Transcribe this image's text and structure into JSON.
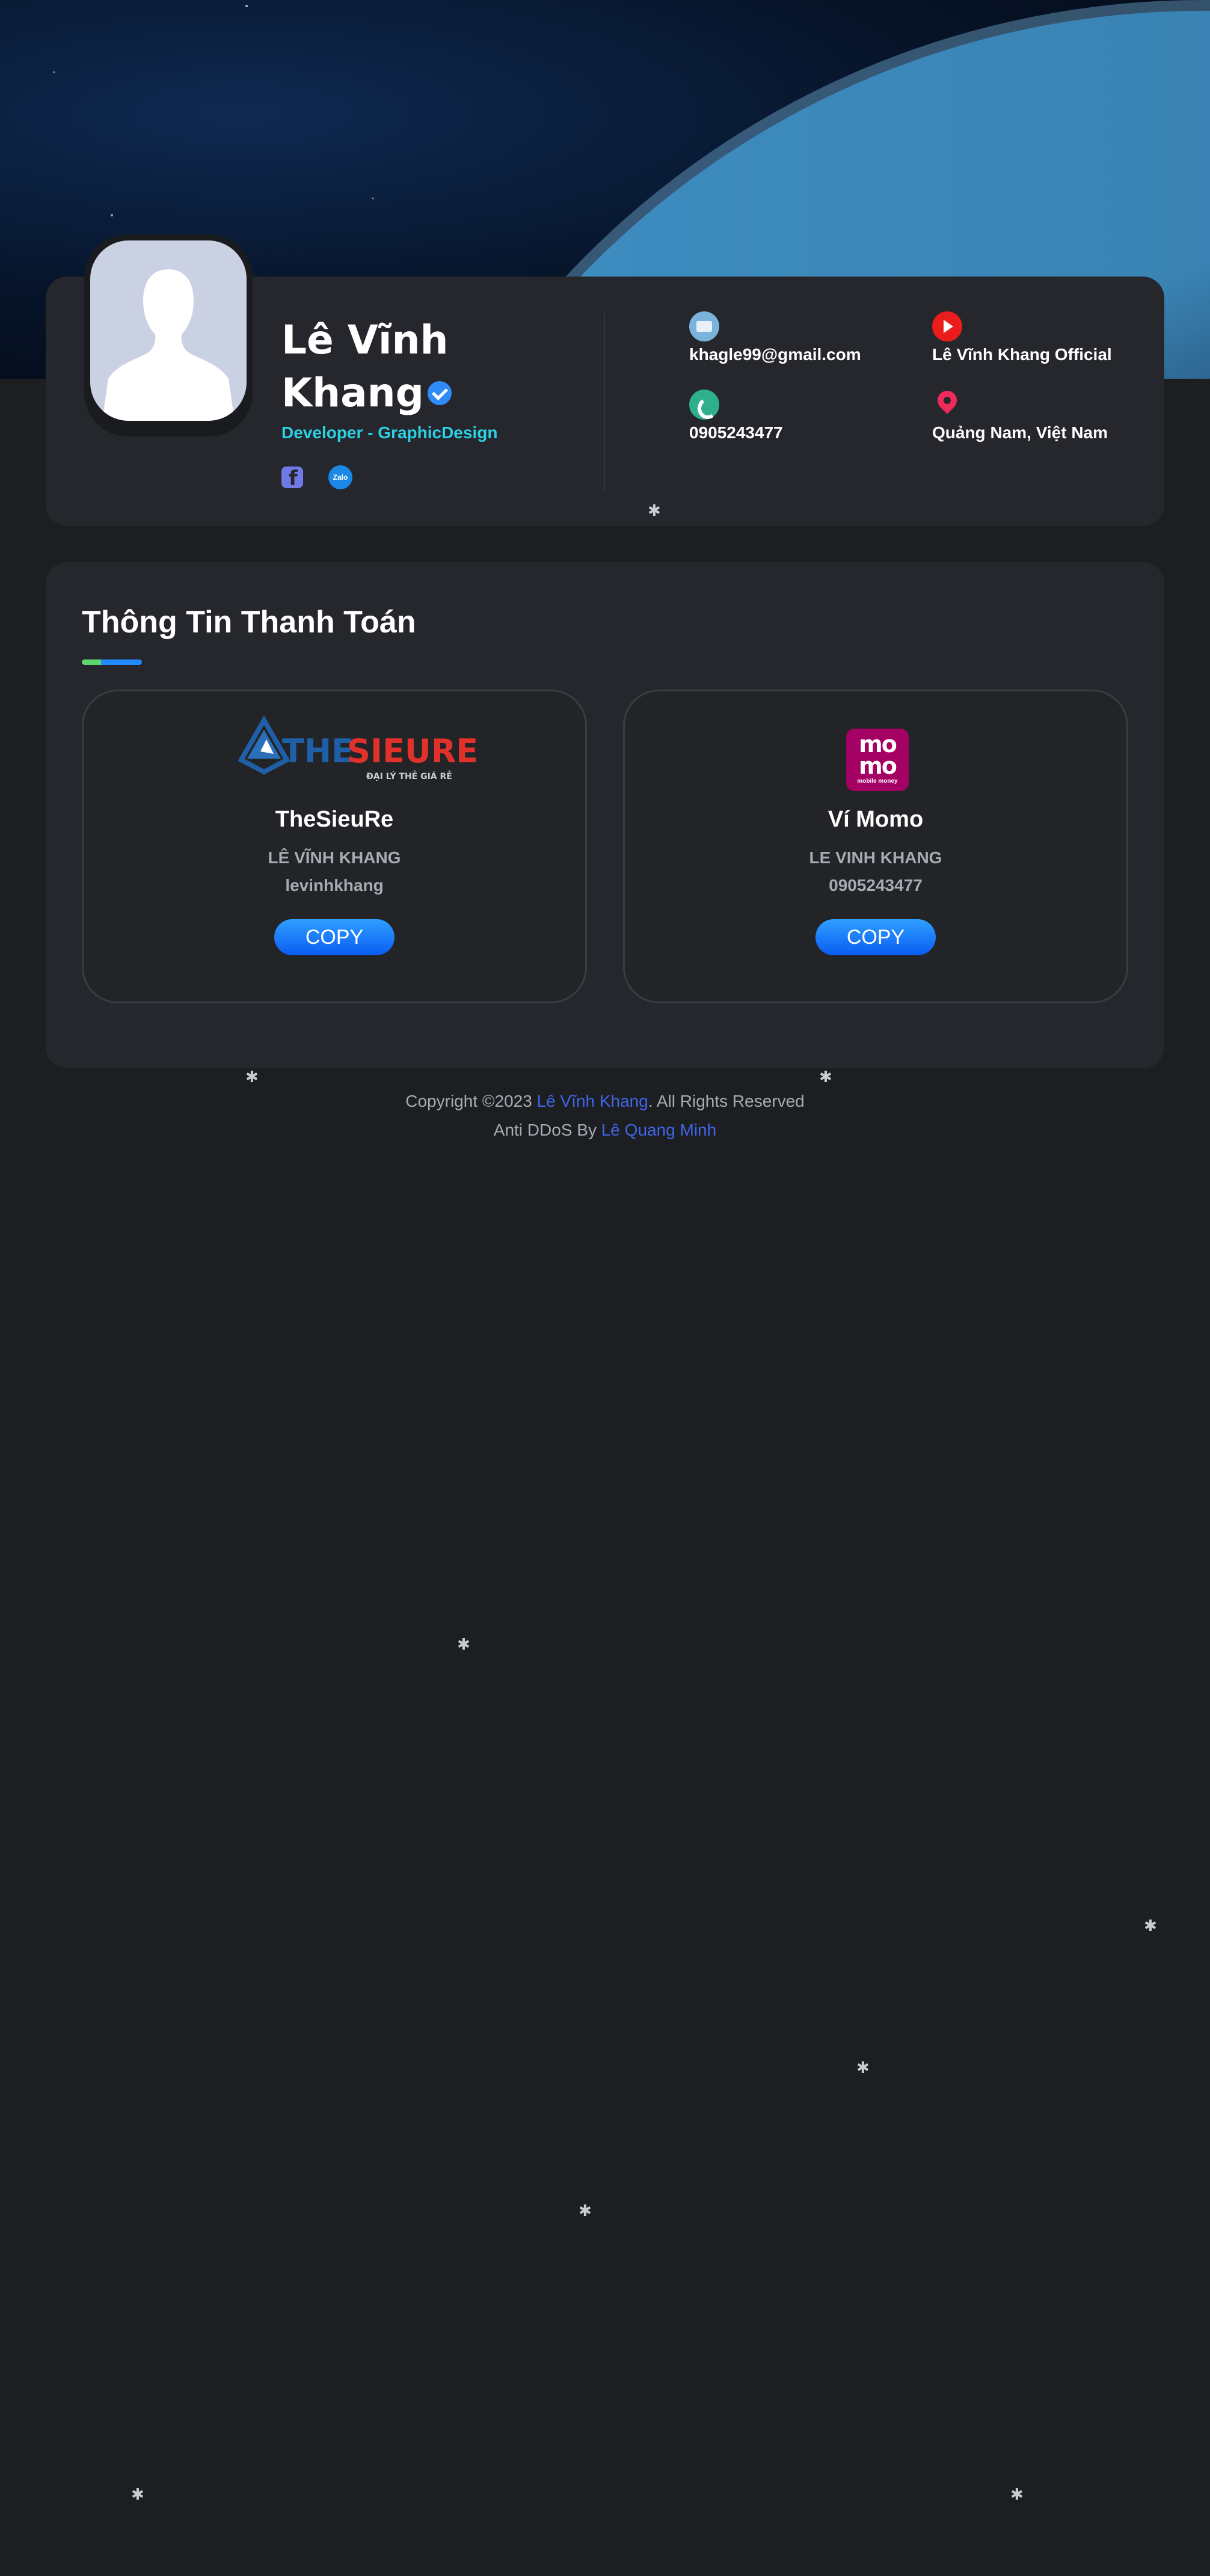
{
  "profile": {
    "name_line1": "Lê Vĩnh",
    "name_line2": "Khang",
    "role": "Developer - GraphicDesign",
    "socials": [
      {
        "name": "facebook-icon"
      },
      {
        "name": "zalo-icon",
        "label": "Zalo"
      }
    ],
    "contacts": {
      "email": "khagle99@gmail.com",
      "youtube": "Lê Vĩnh Khang Official",
      "phone": "0905243477",
      "location": "Quảng Nam, Việt Nam"
    }
  },
  "payment": {
    "title": "Thông Tin Thanh Toán",
    "cards": [
      {
        "name": "TheSieuRe",
        "owner": "LÊ VĨNH KHANG",
        "account": "levinhkhang",
        "button": "COPY",
        "logo_text_1": "THE",
        "logo_text_2": "SIEURE",
        "logo_tagline": "ĐẠI LÝ THẺ GIÁ RẺ"
      },
      {
        "name": "Ví Momo",
        "owner": "LE VINH KHANG",
        "account": "0905243477",
        "button": "COPY",
        "logo_text_1": "mo",
        "logo_text_2": "mo",
        "logo_tagline": "mobile money"
      }
    ]
  },
  "footer": {
    "copyright_prefix": "Copyright ©2023 ",
    "copyright_link": "Lê Vĩnh Khang",
    "copyright_suffix": ". All Rights Reserved",
    "ddos_prefix": "Anti DDoS By ",
    "ddos_link": "Lê Quang Minh"
  },
  "colors": {
    "background": "#1d1e22",
    "card": "#25272c",
    "accent_cyan": "#2ad2e6",
    "link": "#3f66e8",
    "button": "#1a7bff"
  }
}
